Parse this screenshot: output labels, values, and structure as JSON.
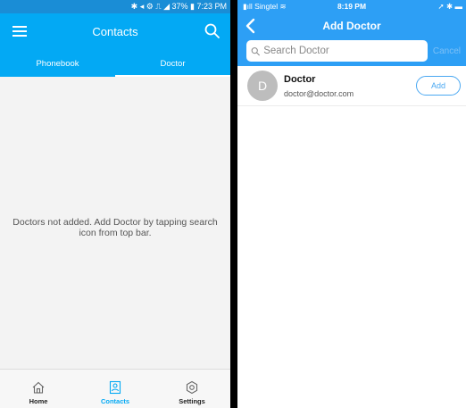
{
  "left": {
    "status_bar": {
      "text": "✱ ◂ ⚙ ⎍ ◢ 37% ▮ 7:23 PM"
    },
    "app_bar": {
      "title": "Contacts"
    },
    "tabs": [
      {
        "label": "Phonebook",
        "active": false
      },
      {
        "label": "Doctor",
        "active": true
      }
    ],
    "empty_message": "Doctors not added. Add Doctor by tapping search icon from top bar.",
    "bottom_nav": [
      {
        "label": "Home",
        "icon": "home-icon",
        "active": false
      },
      {
        "label": "Contacts",
        "icon": "contacts-icon",
        "active": true
      },
      {
        "label": "Settings",
        "icon": "settings-icon",
        "active": false
      }
    ],
    "colors": {
      "primary": "#03a9f4",
      "status": "#1a8dd6"
    }
  },
  "right": {
    "status_bar": {
      "carrier": "▮ıll Singtel ≋",
      "time": "8:19 PM",
      "right": "➚ ✱ ▬"
    },
    "nav_bar": {
      "title": "Add Doctor"
    },
    "search": {
      "placeholder": "Search Doctor",
      "value": "",
      "cancel_label": "Cancel"
    },
    "results": [
      {
        "avatar_letter": "D",
        "name": "Doctor",
        "email": "doctor@doctor.com",
        "action_label": "Add"
      }
    ],
    "colors": {
      "primary": "#2d9ff5",
      "accent": "#4aa8f2"
    }
  }
}
